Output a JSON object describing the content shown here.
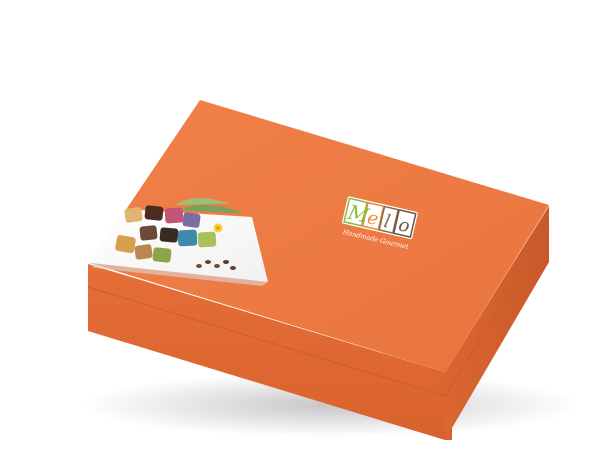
{
  "product": {
    "brand_name": "Melo",
    "tagline": "Handmade Gourmet",
    "box_color": "#ED7A45",
    "box_side_color": "#E06A34",
    "logo_letter_colors": [
      "#8DBB3C",
      "#E98A3A",
      "#8A6B4E",
      "#6B5444"
    ]
  }
}
